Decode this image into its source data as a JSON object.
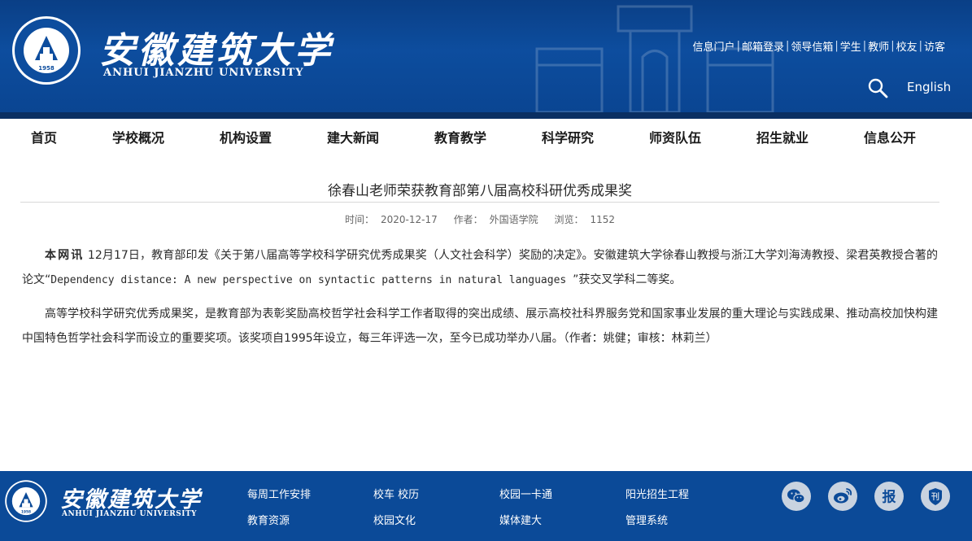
{
  "site": {
    "name_cn": "安徽建筑大学",
    "name_en": "ANHUI JIANZHU UNIVERSITY",
    "founded": "1958"
  },
  "header": {
    "top_links": [
      "信息门户",
      "邮箱登录",
      "领导信箱",
      "学生",
      "教师",
      "校友",
      "访客"
    ],
    "separator": "|",
    "language_label": "English"
  },
  "nav": {
    "items": [
      "首页",
      "学校概况",
      "机构设置",
      "建大新闻",
      "教育教学",
      "科学研究",
      "师资队伍",
      "招生就业",
      "信息公开"
    ]
  },
  "article": {
    "title": "徐春山老师荣获教育部第八届高校科研优秀成果奖",
    "meta": {
      "time_label": "时间：",
      "time": "2020-12-17",
      "author_label": "作者：",
      "author": "外国语学院",
      "views_label": "浏览：",
      "views": "1152"
    },
    "p1_keyword": "本网讯",
    "p1_part1": " 12月17日，教育部印发《关于第八届高等学校科学研究优秀成果奖（人文社会科学）奖励的决定》。安徽建筑大学徐春山教授与浙江大学刘海涛教授、梁君英教授合著的论文“",
    "p1_paper": "Dependency distance: A new perspective on syntactic patterns in natural languages ",
    "p1_part2": "”获交叉学科二等奖。",
    "p2": "高等学校科学研究优秀成果奖，是教育部为表彰奖励高校哲学社会科学工作者取得的突出成绩、展示高校社科界服务党和国家事业发展的重大理论与实践成果、推动高校加快构建中国特色哲学社会科学而设立的重要奖项。该奖项自1995年设立，每三年评选一次，至今已成功举办八届。（作者：姚健；审核：林莉兰）"
  },
  "footer": {
    "name_cn": "安徽建筑大学",
    "name_en": "ANHUI JIANZHU UNIVERSITY",
    "links_row1": [
      "每周工作安排",
      "校车 校历",
      "校园一卡通",
      "阳光招生工程"
    ],
    "links_row2": [
      "教育资源",
      "校园文化",
      "媒体建大",
      "管理系统"
    ],
    "social": [
      {
        "icon": "wechat-icon",
        "glyph": ""
      },
      {
        "icon": "weibo-icon",
        "glyph": ""
      },
      {
        "icon": "newspaper-icon",
        "glyph": "报"
      },
      {
        "icon": "journal-icon",
        "glyph": "刊"
      }
    ]
  },
  "colors": {
    "header_blue": "#0d4d9e",
    "footer_blue": "#0b4a98",
    "text": "#2b2b2b"
  }
}
